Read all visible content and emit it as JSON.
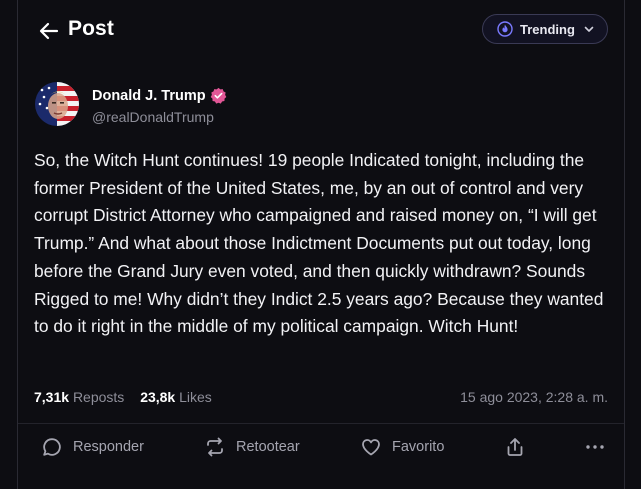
{
  "header": {
    "title": "Post",
    "trending_label": "Trending"
  },
  "author": {
    "name": "Donald J. Trump",
    "handle": "@realDonaldTrump",
    "verified_color": "#e25797"
  },
  "post": {
    "text": "So, the Witch Hunt continues! 19 people Indicated tonight, including the former President of the United States, me, by an out of control and very corrupt District Attorney who campaigned and raised money on, “I will get Trump.” And what about those Indictment Documents put out today, long before the Grand Jury even voted, and then quickly withdrawn? Sounds Rigged to me! Why didn’t they Indict 2.5 years ago? Because they wanted to do it right in the middle of my political campaign. Witch Hunt!"
  },
  "stats": {
    "reposts_count": "7,31k",
    "reposts_label": "Reposts",
    "likes_count": "23,8k",
    "likes_label": "Likes",
    "timestamp": "15 ago 2023, 2:28 a. m."
  },
  "actions": {
    "reply_label": "Responder",
    "retweet_label": "Retootear",
    "favorite_label": "Favorito"
  },
  "colors": {
    "background": "#0d0d12",
    "accent": "#6b6bff"
  }
}
